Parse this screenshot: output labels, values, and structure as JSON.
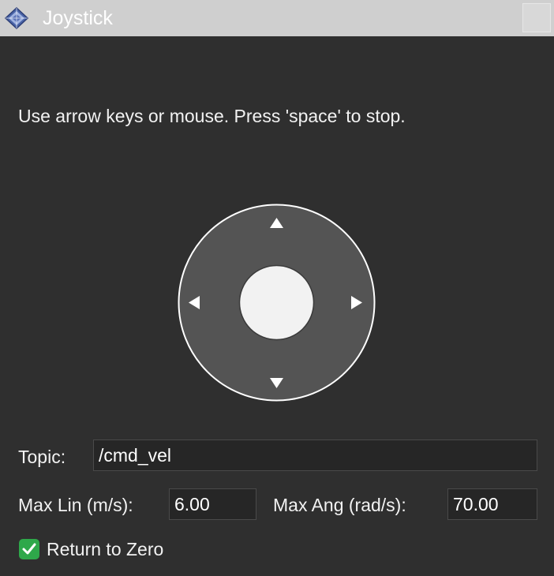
{
  "window": {
    "title": "Joystick",
    "app_icon": "diamond-app-icon"
  },
  "instructions": "Use arrow keys or mouse. Press 'space' to stop.",
  "joystick": {
    "pad_color": "#545454",
    "knob_color": "#f2f2f2",
    "arrow_up": "▲",
    "arrow_down": "▼",
    "arrow_left": "◀",
    "arrow_right": "▶"
  },
  "topic": {
    "label": "Topic:",
    "value": "/cmd_vel"
  },
  "max_lin": {
    "label": "Max Lin (m/s):",
    "value": "6.00"
  },
  "max_ang": {
    "label": "Max Ang (rad/s):",
    "value": "70.00"
  },
  "return_to_zero": {
    "label": "Return to Zero",
    "checked": true,
    "check_color": "#2ea84a"
  }
}
